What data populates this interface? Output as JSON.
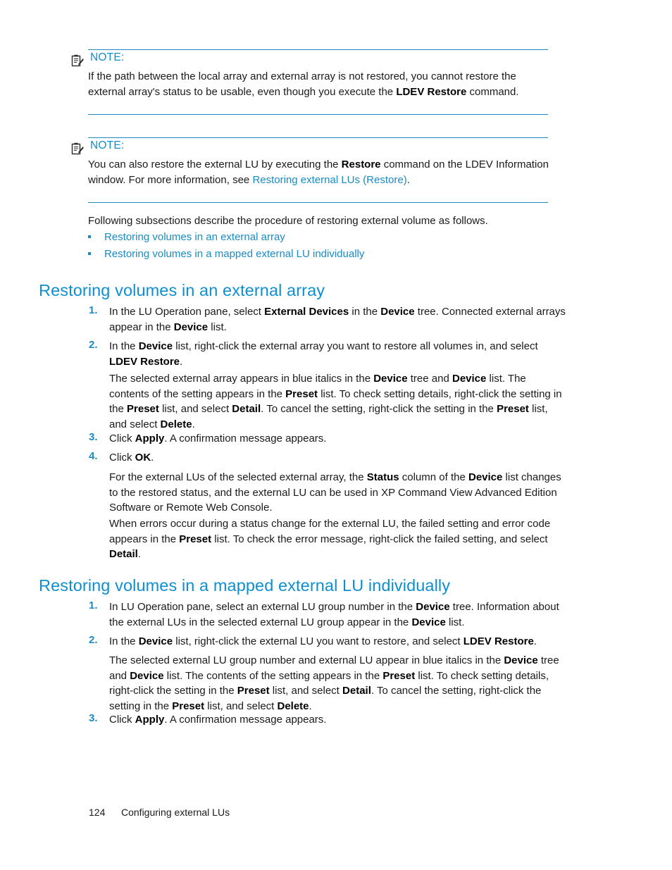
{
  "theme": {
    "accent_blue": "#0e8fd0",
    "rule_blue": "#1a8bc4",
    "body_black": "#1a1a1a"
  },
  "notes": [
    {
      "label": "NOTE:",
      "icon": "note-clipboard-icon",
      "text_parts": [
        {
          "t": "If the path between the local array and external array is not restored, you cannot restore the external array's status to be usable, even though you execute the ",
          "style": "normal"
        },
        {
          "t": "LDEV Restore",
          "style": "bold"
        },
        {
          "t": " command.",
          "style": "normal"
        }
      ],
      "plain": "If the path between the local array and external array is not restored, you cannot restore the external array's status to be usable, even though you execute the LDEV Restore command."
    },
    {
      "label": "NOTE:",
      "icon": "note-clipboard-icon",
      "text_parts": [
        {
          "t": "You can also restore the external LU by executing the ",
          "style": "normal"
        },
        {
          "t": "Restore",
          "style": "bold"
        },
        {
          "t": " command on the LDEV Information window. For more information, see ",
          "style": "normal"
        },
        {
          "t": "Restoring external LUs (Restore)",
          "style": "link"
        },
        {
          "t": ".",
          "style": "normal"
        }
      ],
      "plain": "You can also restore the external LU by executing the Restore command on the LDEV Information window. For more information, see Restoring external LUs (Restore)."
    }
  ],
  "intro": {
    "text": "Following subsections describe the procedure of restoring external volume as follows."
  },
  "bullets": [
    {
      "label": "Restoring volumes in an external array"
    },
    {
      "label": "Restoring volumes in a mapped external LU individually"
    }
  ],
  "sections": [
    {
      "heading": "Restoring volumes in an external array",
      "steps": [
        {
          "num": "1.",
          "parts": [
            {
              "t": "In the LU Operation pane, select ",
              "style": "normal"
            },
            {
              "t": "External Devices",
              "style": "bold"
            },
            {
              "t": " in the ",
              "style": "normal"
            },
            {
              "t": "Device",
              "style": "bold"
            },
            {
              "t": " tree. Connected external arrays appear in the ",
              "style": "normal"
            },
            {
              "t": "Device",
              "style": "bold"
            },
            {
              "t": " list.",
              "style": "normal"
            }
          ]
        },
        {
          "num": "2.",
          "parts": [
            {
              "t": "In the ",
              "style": "normal"
            },
            {
              "t": "Device",
              "style": "bold"
            },
            {
              "t": " list, right-click the external array you want to restore all volumes in, and select ",
              "style": "normal"
            },
            {
              "t": "LDEV Restore",
              "style": "bold"
            },
            {
              "t": ".",
              "style": "normal"
            }
          ]
        },
        {
          "num": "",
          "parts": [
            {
              "t": "The selected external array appears in blue italics in the ",
              "style": "normal"
            },
            {
              "t": "Device",
              "style": "bold"
            },
            {
              "t": " tree and ",
              "style": "normal"
            },
            {
              "t": "Device",
              "style": "bold"
            },
            {
              "t": " list. The contents of the setting appears in the ",
              "style": "normal"
            },
            {
              "t": "Preset",
              "style": "bold"
            },
            {
              "t": " list. To check setting details, right-click the setting in the ",
              "style": "normal"
            },
            {
              "t": "Preset",
              "style": "bold"
            },
            {
              "t": " list, and select ",
              "style": "normal"
            },
            {
              "t": "Detail",
              "style": "bold"
            },
            {
              "t": ". To cancel the setting, right-click the setting in the ",
              "style": "normal"
            },
            {
              "t": "Preset",
              "style": "bold"
            },
            {
              "t": " list, and select ",
              "style": "normal"
            },
            {
              "t": "Delete",
              "style": "bold"
            },
            {
              "t": ".",
              "style": "normal"
            }
          ]
        },
        {
          "num": "3.",
          "parts": [
            {
              "t": "Click ",
              "style": "normal"
            },
            {
              "t": "Apply",
              "style": "bold"
            },
            {
              "t": ". A confirmation message appears.",
              "style": "normal"
            }
          ]
        },
        {
          "num": "4.",
          "parts": [
            {
              "t": "Click ",
              "style": "normal"
            },
            {
              "t": "OK",
              "style": "bold"
            },
            {
              "t": ".",
              "style": "normal"
            }
          ]
        },
        {
          "num": "",
          "parts": [
            {
              "t": "For the external LUs of the selected external array, the ",
              "style": "normal"
            },
            {
              "t": "Status",
              "style": "bold"
            },
            {
              "t": " column of the ",
              "style": "normal"
            },
            {
              "t": "Device",
              "style": "bold"
            },
            {
              "t": " list changes to the restored status, and the external LU can be used in XP Command View Advanced Edition Software or Remote Web Console.",
              "style": "normal"
            }
          ]
        },
        {
          "num": "",
          "parts": [
            {
              "t": "When errors occur during a status change for the external LU, the failed setting and error code appears in the ",
              "style": "normal"
            },
            {
              "t": "Preset",
              "style": "bold"
            },
            {
              "t": " list. To check the error message, right-click the failed setting, and select ",
              "style": "normal"
            },
            {
              "t": "Detail",
              "style": "bold"
            },
            {
              "t": ".",
              "style": "normal"
            }
          ]
        }
      ]
    },
    {
      "heading": "Restoring volumes in a mapped external LU individually",
      "steps": [
        {
          "num": "1.",
          "parts": [
            {
              "t": "In LU Operation pane, select an external LU group number in the ",
              "style": "normal"
            },
            {
              "t": "Device",
              "style": "bold"
            },
            {
              "t": " tree. Information about the external LUs in the selected external LU group appear in the ",
              "style": "normal"
            },
            {
              "t": "Device",
              "style": "bold"
            },
            {
              "t": " list.",
              "style": "normal"
            }
          ]
        },
        {
          "num": "2.",
          "parts": [
            {
              "t": "In the ",
              "style": "normal"
            },
            {
              "t": "Device",
              "style": "bold"
            },
            {
              "t": " list, right-click the external LU you want to restore, and select ",
              "style": "normal"
            },
            {
              "t": "LDEV Restore",
              "style": "bold"
            },
            {
              "t": ".",
              "style": "normal"
            }
          ]
        },
        {
          "num": "",
          "parts": [
            {
              "t": "The selected external LU group number and external LU appear in blue italics in the ",
              "style": "normal"
            },
            {
              "t": "Device",
              "style": "bold"
            },
            {
              "t": " tree and ",
              "style": "normal"
            },
            {
              "t": "Device",
              "style": "bold"
            },
            {
              "t": " list. The contents of the setting appears in the ",
              "style": "normal"
            },
            {
              "t": "Preset",
              "style": "bold"
            },
            {
              "t": " list. To check setting details, right-click the setting in the ",
              "style": "normal"
            },
            {
              "t": "Preset",
              "style": "bold"
            },
            {
              "t": " list, and select ",
              "style": "normal"
            },
            {
              "t": "Detail",
              "style": "bold"
            },
            {
              "t": ". To cancel the setting, right-click the setting in the ",
              "style": "normal"
            },
            {
              "t": "Preset",
              "style": "bold"
            },
            {
              "t": " list, and select ",
              "style": "normal"
            },
            {
              "t": "Delete",
              "style": "bold"
            },
            {
              "t": ".",
              "style": "normal"
            }
          ]
        },
        {
          "num": "3.",
          "parts": [
            {
              "t": "Click ",
              "style": "normal"
            },
            {
              "t": "Apply",
              "style": "bold"
            },
            {
              "t": ". A confirmation message appears.",
              "style": "normal"
            }
          ]
        }
      ]
    }
  ],
  "footer": {
    "page_number": "124",
    "chapter": "Configuring external LUs"
  }
}
